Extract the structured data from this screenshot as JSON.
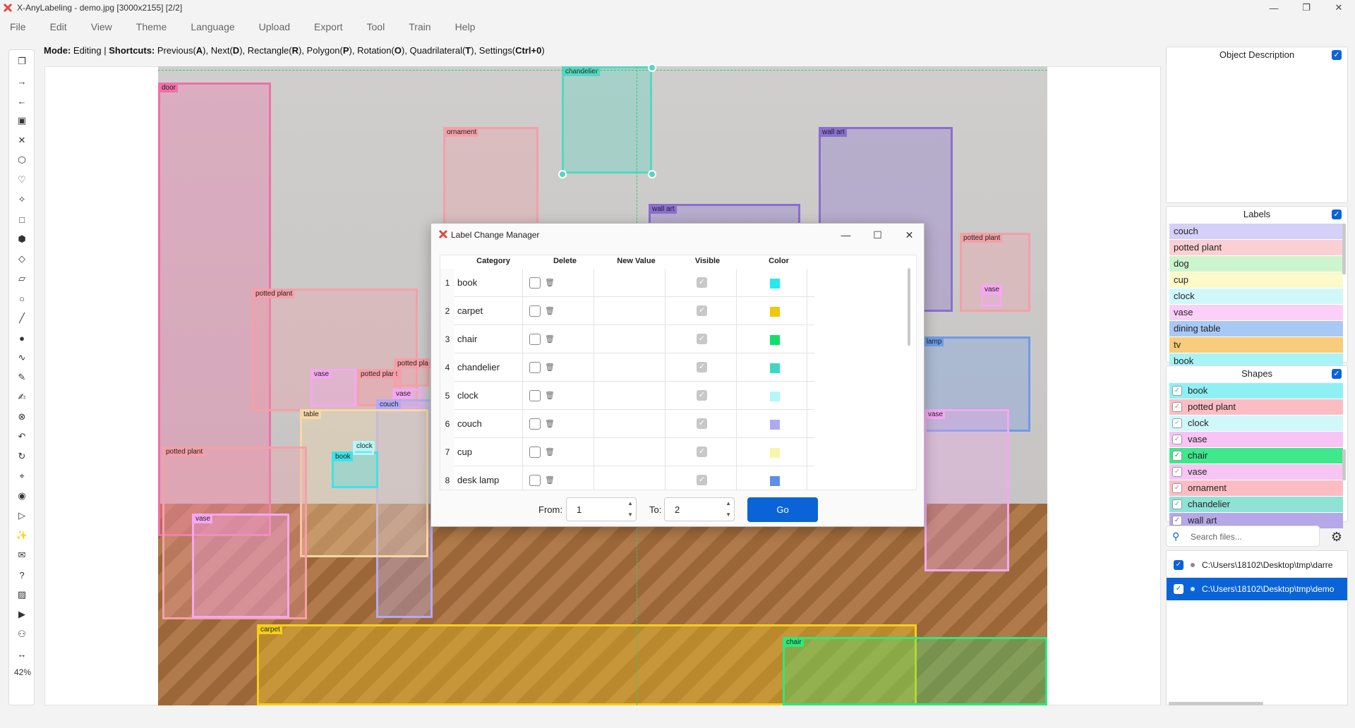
{
  "app": {
    "title": "X-AnyLabeling - demo.jpg [3000x2155] [2/2]"
  },
  "menu": [
    "File",
    "Edit",
    "View",
    "Theme",
    "Language",
    "Upload",
    "Export",
    "Tool",
    "Train",
    "Help"
  ],
  "modebar": {
    "mode_label": "Mode:",
    "mode_value": " Editing | ",
    "shortcuts_label": "Shortcuts:",
    "s1": " Previous(",
    "k1": "A",
    "s2": "), Next(",
    "k2": "D",
    "s3": "), Rectangle(",
    "k3": "R",
    "s4": "), Polygon(",
    "k4": "P",
    "s5": "), Rotation(",
    "k5": "O",
    "s6": "), Quadrilateral(",
    "k6": "T",
    "s7": "), Settings(",
    "k7": "Ctrl+0",
    "s8": ")"
  },
  "zoom": "42%",
  "toolbar_icons": [
    "open-dir-icon",
    "next-image-icon",
    "prev-image-icon",
    "save-icon",
    "delete-file-icon",
    "polygon-icon",
    "heart-shape-icon",
    "magic-wand-icon",
    "rectangle-icon",
    "cube-icon",
    "rotation-icon",
    "quadrilateral-icon",
    "circle-icon",
    "line-icon",
    "point-icon",
    "linestrip-icon",
    "brush-icon",
    "edit-icon",
    "cancel-icon",
    "undo-icon",
    "loop-icon",
    "pointer-icon",
    "visibility-icon",
    "play-icon",
    "sparkle-icon",
    "chat-icon",
    "help-icon",
    "image-icon",
    "video-icon",
    "group-icon",
    "fit-width-icon"
  ],
  "annotations": [
    {
      "label": "door",
      "color": "#f06fa8"
    },
    {
      "label": "ornament",
      "color": "#f4a0a8"
    },
    {
      "label": "chandelier",
      "color": "#56d6c2"
    },
    {
      "label": "wall art",
      "color": "#8a6fd0"
    },
    {
      "label": "wall art",
      "color": "#8a6fd0"
    },
    {
      "label": "potted plant",
      "color": "#f4a0a8"
    },
    {
      "label": "vase",
      "color": "#f3a8f0"
    },
    {
      "label": "potted plant",
      "color": "#f4a0a8"
    },
    {
      "label": "potted pla",
      "color": "#f4a0a8"
    },
    {
      "label": "vase",
      "color": "#f3a8f0"
    },
    {
      "label": "couch",
      "color": "#b2aaf4"
    },
    {
      "label": "table",
      "color": "#f7d7a8"
    },
    {
      "label": "book",
      "color": "#3fe2e8"
    },
    {
      "label": "clock",
      "color": "#b6f7fa"
    },
    {
      "label": "potted plant",
      "color": "#f4a0a8"
    },
    {
      "label": "vase",
      "color": "#f3a8f0"
    },
    {
      "label": "potted plant",
      "color": "#f4a0a8"
    },
    {
      "label": "vase",
      "color": "#f3a8f0"
    },
    {
      "label": "k lamp",
      "color": "#6f9be8"
    },
    {
      "label": "vase",
      "color": "#f3a8f0"
    },
    {
      "label": "carpet",
      "color": "#f5cf18"
    },
    {
      "label": "chair",
      "color": "#2ee87a"
    }
  ],
  "dialog": {
    "title": "Label Change Manager",
    "headers": [
      "Category",
      "Delete",
      "New Value",
      "Visible",
      "Color"
    ],
    "rows": [
      {
        "n": "1",
        "category": "book",
        "color": "#28e8f0"
      },
      {
        "n": "2",
        "category": "carpet",
        "color": "#f2c70a"
      },
      {
        "n": "3",
        "category": "chair",
        "color": "#10e06a"
      },
      {
        "n": "4",
        "category": "chandelier",
        "color": "#3cd8c4"
      },
      {
        "n": "5",
        "category": "clock",
        "color": "#b4f7fa"
      },
      {
        "n": "6",
        "category": "couch",
        "color": "#b0a8f4"
      },
      {
        "n": "7",
        "category": "cup",
        "color": "#f8f5a8"
      },
      {
        "n": "8",
        "category": "desk lamp",
        "color": "#5d8ee8"
      }
    ],
    "from_label": "From:",
    "from_value": "1",
    "to_label": "To:",
    "to_value": "2",
    "go_label": "Go"
  },
  "object_description": {
    "title": "Object Description"
  },
  "labels": {
    "title": "Labels",
    "items": [
      {
        "name": "couch",
        "color": "#d5d0f8"
      },
      {
        "name": "potted plant",
        "color": "#fbd0d4"
      },
      {
        "name": "dog",
        "color": "#cdf5cd"
      },
      {
        "name": "cup",
        "color": "#fbfac8"
      },
      {
        "name": "clock",
        "color": "#d0f8fb"
      },
      {
        "name": "vase",
        "color": "#fad0f8"
      },
      {
        "name": "dining table",
        "color": "#a9c9f5"
      },
      {
        "name": "tv",
        "color": "#f8cc7a"
      },
      {
        "name": "book",
        "color": "#a8f3f6"
      }
    ]
  },
  "shapes": {
    "title": "Shapes",
    "items": [
      {
        "name": "book",
        "color": "#8ff0f4",
        "mark": "#28b8c0"
      },
      {
        "name": "potted plant",
        "color": "#fbbdc3",
        "mark": "#e0707c"
      },
      {
        "name": "clock",
        "color": "#d0f8fb",
        "mark": "#7cc"
      },
      {
        "name": "vase",
        "color": "#f7c4f4",
        "mark": "#d070d0"
      },
      {
        "name": "chair",
        "color": "#3fe88a",
        "mark": "#10a050"
      },
      {
        "name": "vase",
        "color": "#f7c4f4",
        "mark": "#d070d0"
      },
      {
        "name": "ornament",
        "color": "#fbbdc3",
        "mark": "#e0707c"
      },
      {
        "name": "chandelier",
        "color": "#8fe3d6",
        "mark": "#3cb4a4"
      },
      {
        "name": "wall art",
        "color": "#b6a8e8",
        "mark": "#7060c0"
      }
    ]
  },
  "files": {
    "search_placeholder": "Search files...",
    "items": [
      {
        "path": "C:\\Users\\18102\\Desktop\\tmp\\darre",
        "selected": false
      },
      {
        "path": "C:\\Users\\18102\\Desktop\\tmp\\demo",
        "selected": true
      }
    ]
  }
}
